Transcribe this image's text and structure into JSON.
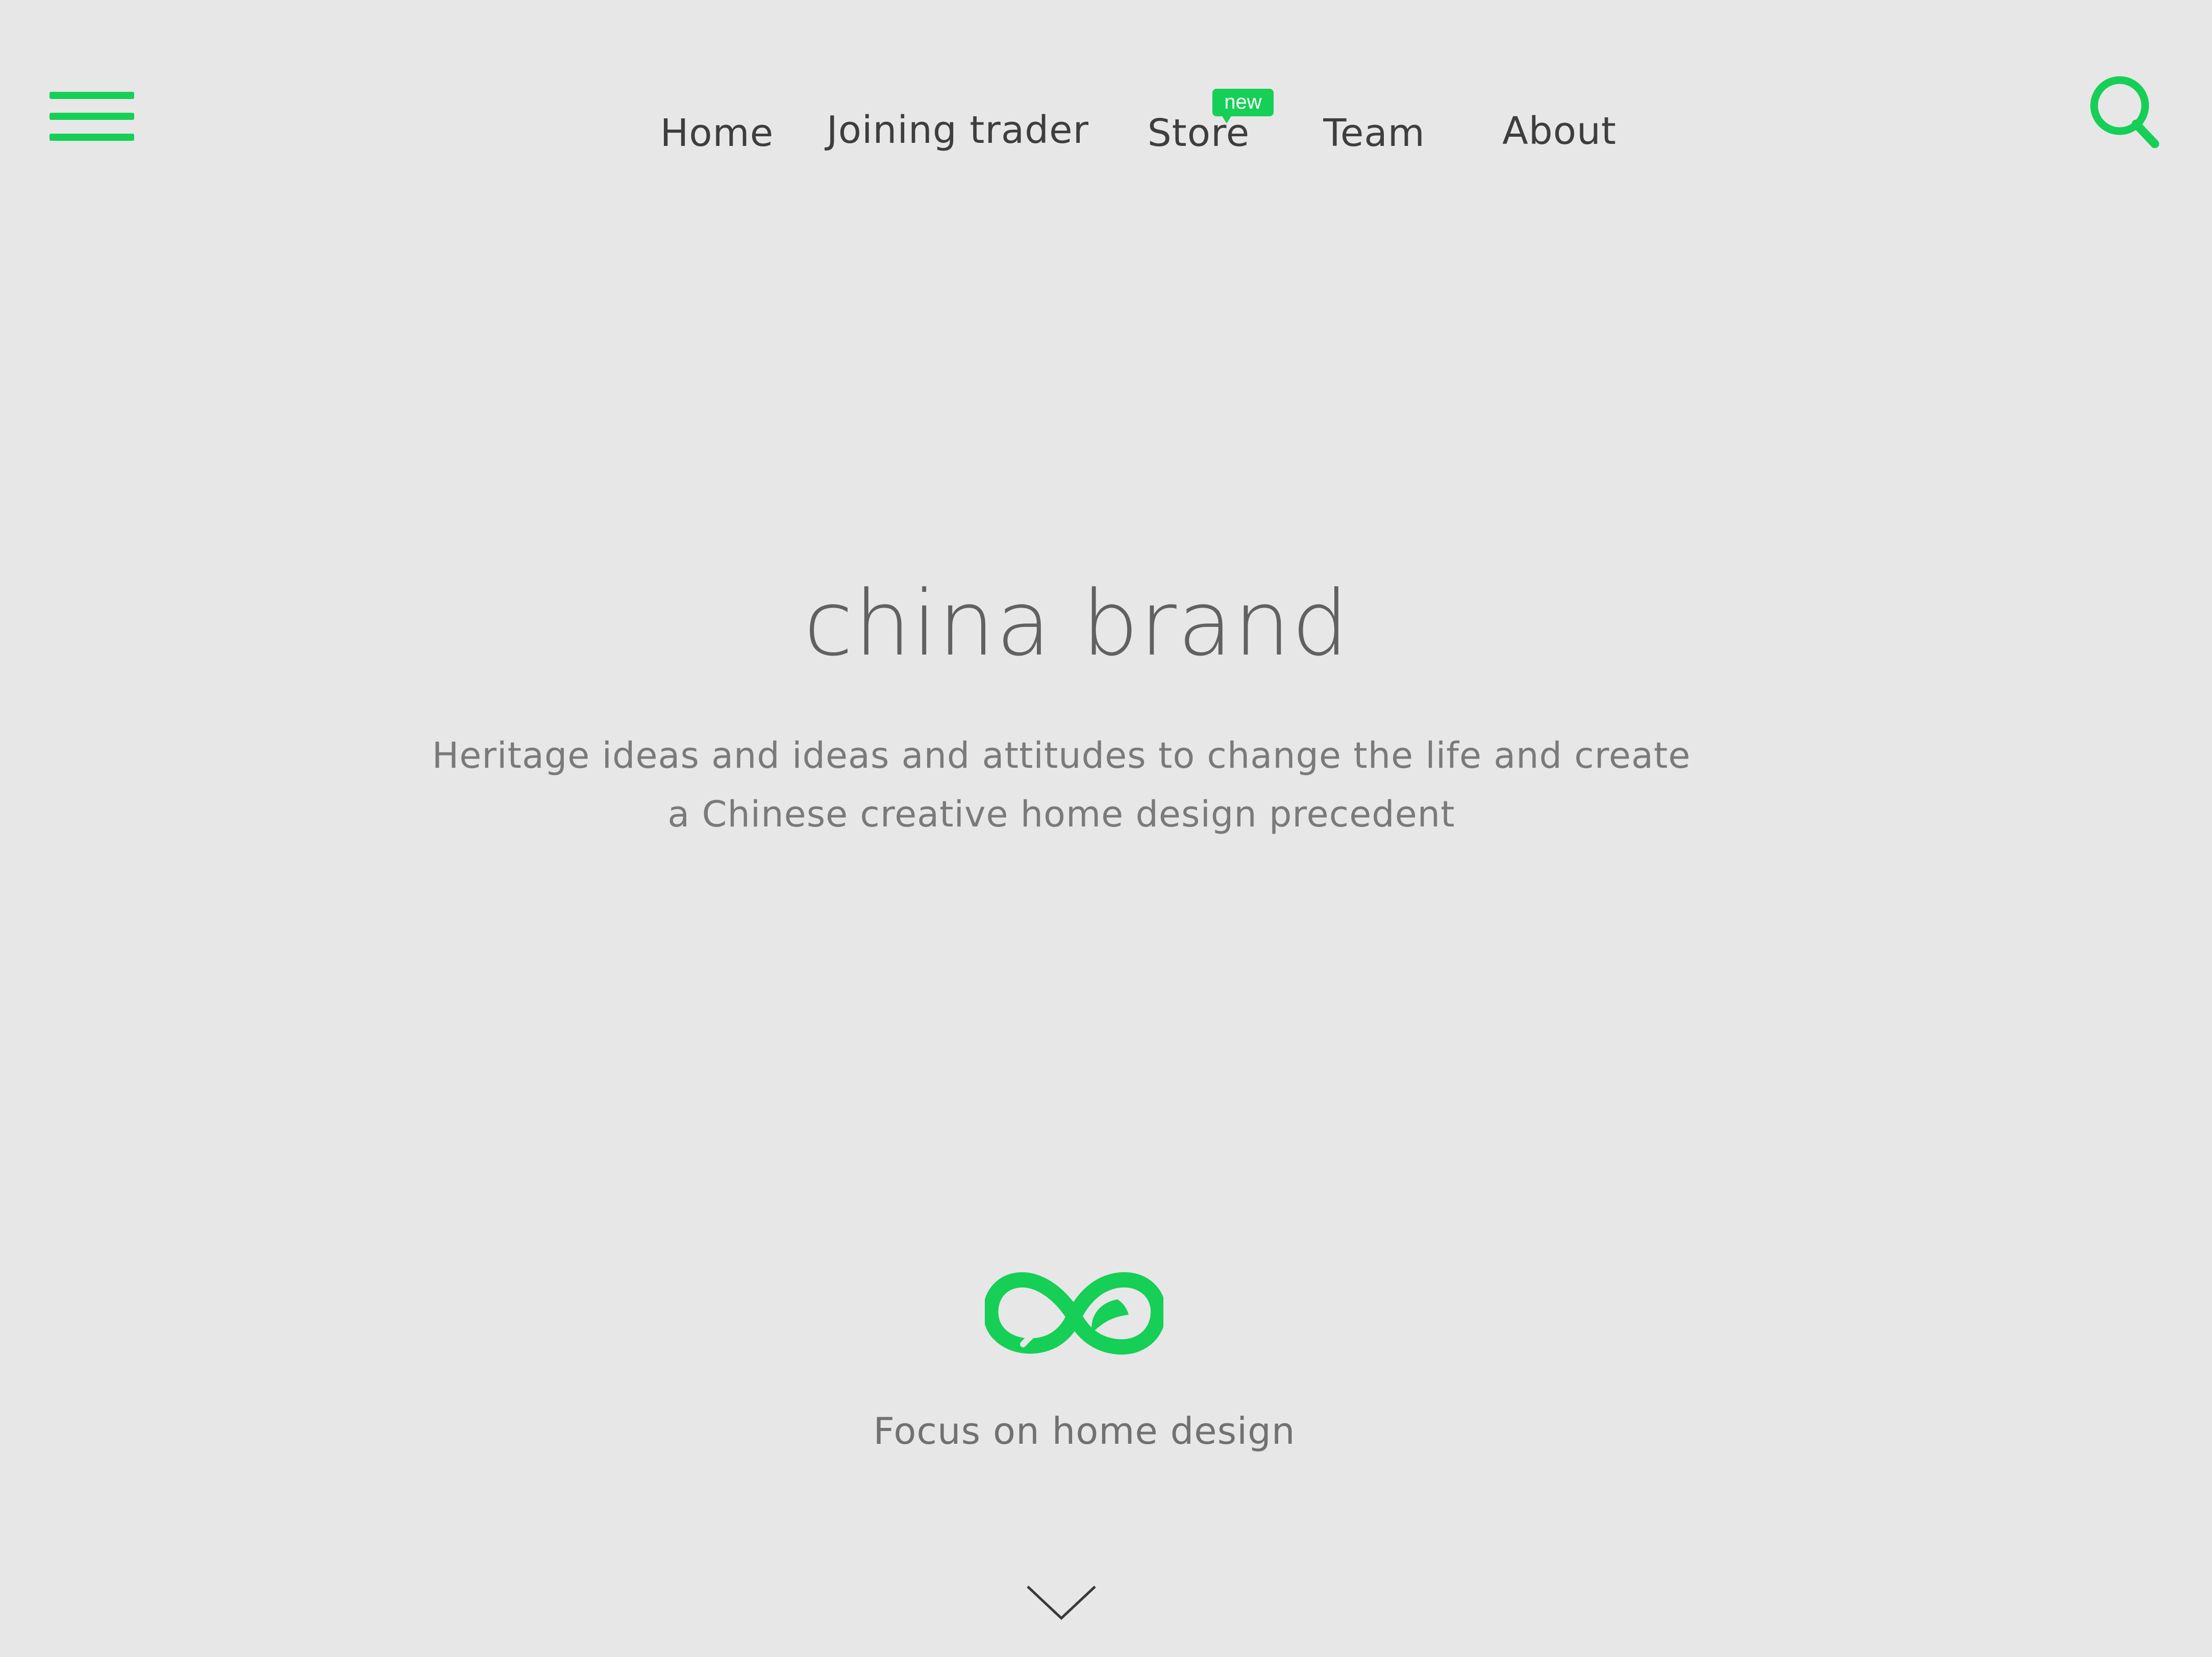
{
  "header": {
    "menu_icon": "hamburger-menu-icon",
    "search_icon": "search-icon",
    "accent_color": "#15cf56"
  },
  "nav": {
    "items": [
      {
        "label": "Home"
      },
      {
        "label": "Joining trader"
      },
      {
        "label": "Store",
        "badge": "new"
      },
      {
        "label": "Team"
      },
      {
        "label": "About"
      }
    ]
  },
  "hero": {
    "title": "china brand",
    "subtitle_line1": "Heritage ideas and ideas and attitudes to  change the life and create",
    "subtitle_line2": "a Chinese creative home design precedent"
  },
  "brand": {
    "logo_icon": "infinity-leaf-logo-icon",
    "tagline": "Focus on home design"
  },
  "scroll": {
    "icon": "chevron-down-icon"
  }
}
